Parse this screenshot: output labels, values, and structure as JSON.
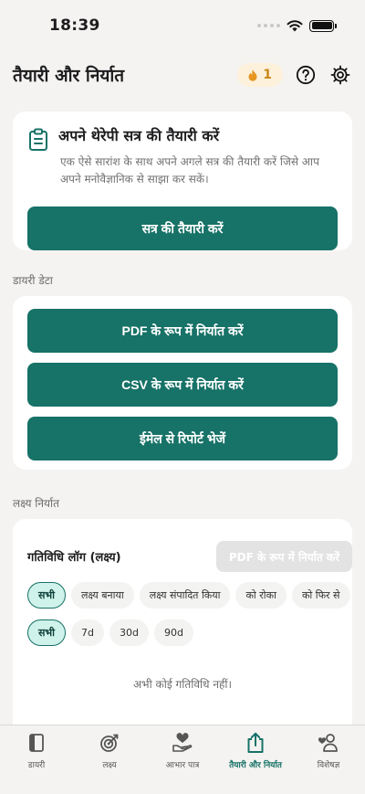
{
  "status": {
    "time": "18:39"
  },
  "header": {
    "title": "तैयारी और निर्यात",
    "streak_count": "1"
  },
  "prep": {
    "title": "अपने थेरेपी सत्र की तैयारी करें",
    "description": "एक ऐसे सारांश के साथ अपने अगले सत्र की तैयारी करें जिसे आप अपने मनोवैज्ञानिक से साझा कर सकें।",
    "button": "सत्र की तैयारी करें"
  },
  "diary": {
    "section": "डायरी डेटा",
    "export_pdf": "PDF के रूप में निर्यात करें",
    "export_csv": "CSV के रूप में निर्यात करें",
    "email_report": "ईमेल से रिपोर्ट भेजें"
  },
  "goals": {
    "section": "लक्ष्य निर्यात",
    "log_title": "गतिविधि लॉग (लक्ष्य)",
    "export_pdf": "PDF के रूप में निर्यात करें",
    "filters": [
      "सभी",
      "लक्ष्य बनाया",
      "लक्ष्य संपादित किया",
      "को रोका",
      "को फिर से"
    ],
    "ranges": [
      "सभी",
      "7d",
      "30d",
      "90d"
    ],
    "empty": "अभी कोई गतिविधि नहीं।"
  },
  "tabs": [
    {
      "label": "डायरी"
    },
    {
      "label": "लक्ष्य"
    },
    {
      "label": "आभार पात्र"
    },
    {
      "label": "तैयारी और निर्यात"
    },
    {
      "label": "विशेषज्ञ"
    }
  ],
  "colors": {
    "accent": "#177267",
    "streak": "#c9891a"
  }
}
